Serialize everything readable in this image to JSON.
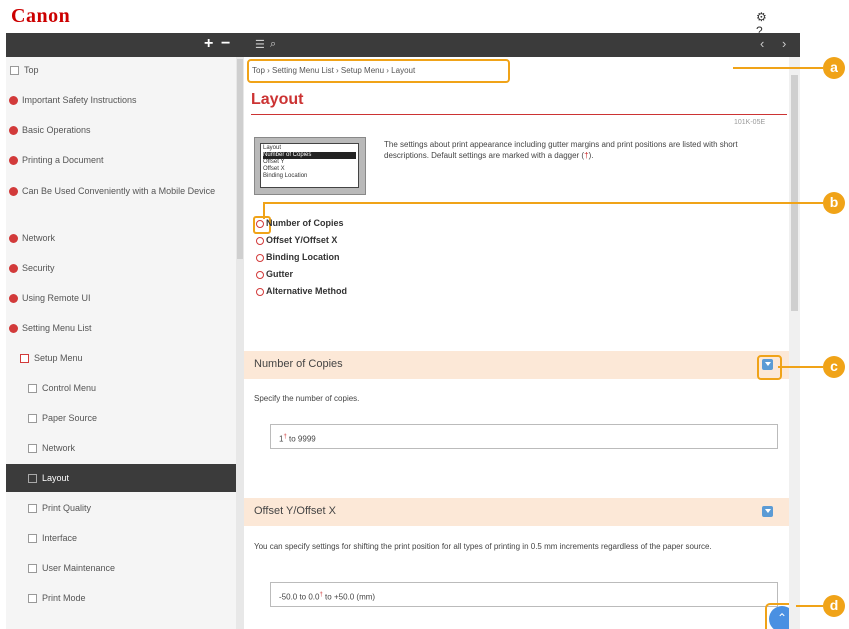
{
  "brand": {
    "logo_text": "Canon",
    "color": "#cc0000"
  },
  "topbar": {
    "settings_icon": "gear-icon",
    "help_label": "?"
  },
  "sidebar": {
    "expand_label": "+",
    "collapse_label": "−",
    "items": [
      {
        "label": "Top",
        "type": "page"
      },
      {
        "label": "Important Safety Instructions",
        "type": "chapter"
      },
      {
        "label": "Basic Operations",
        "type": "chapter"
      },
      {
        "label": "Printing a Document",
        "type": "chapter"
      },
      {
        "label": "Can Be Used Conveniently with a Mobile Device",
        "type": "chapter"
      },
      {
        "label": "Network",
        "type": "chapter"
      },
      {
        "label": "Security",
        "type": "chapter"
      },
      {
        "label": "Using Remote UI",
        "type": "chapter"
      },
      {
        "label": "Setting Menu List",
        "type": "chapter"
      },
      {
        "label": "Setup Menu",
        "type": "section"
      },
      {
        "label": "Control Menu",
        "type": "page"
      },
      {
        "label": "Paper Source",
        "type": "page"
      },
      {
        "label": "Network",
        "type": "page"
      },
      {
        "label": "Layout",
        "type": "page-active"
      },
      {
        "label": "Print Quality",
        "type": "page"
      },
      {
        "label": "Interface",
        "type": "page"
      },
      {
        "label": "User Maintenance",
        "type": "page"
      },
      {
        "label": "Print Mode",
        "type": "page"
      }
    ]
  },
  "content_header": {
    "menu_icon": "list-icon",
    "search_icon": "search-icon",
    "prev": "‹",
    "next": "›"
  },
  "breadcrumb": "Top › Setting Menu List › Setup Menu › Layout",
  "page": {
    "title": "Layout",
    "doc_id": "101K-05E",
    "lcd_lines": [
      "Layout",
      "Number of Copies",
      "Offset Y",
      "Offset X",
      "Binding Location"
    ],
    "description": "The settings about print appearance including gutter margins and print positions are listed with short descriptions. Default settings are marked with a dagger (",
    "dagger": "†",
    "description_end": ").",
    "links": [
      "Number of Copies",
      "Offset Y/Offset X",
      "Binding Location",
      "Gutter",
      "Alternative Method"
    ]
  },
  "sections": [
    {
      "title": "Number of Copies",
      "text": "Specify the number of copies.",
      "value_pre": "1",
      "value_dagger": "†",
      "value_post": " to 9999"
    },
    {
      "title": "Offset Y/Offset X",
      "text": "You can specify settings for shifting the print position for all types of printing in 0.5 mm increments regardless of the paper source.",
      "value_pre": "-50.0 to 0.0",
      "value_dagger": "†",
      "value_post": " to +50.0 (mm)"
    }
  ],
  "callouts": [
    "a",
    "b",
    "c",
    "d"
  ],
  "to_top_icon": "arrow-up-icon",
  "colors": {
    "accent": "#cc3333",
    "callout": "#f0a318",
    "section_bg": "#fce8d7",
    "dark_bar": "#3b3b3b",
    "button_blue": "#4a90e2"
  }
}
